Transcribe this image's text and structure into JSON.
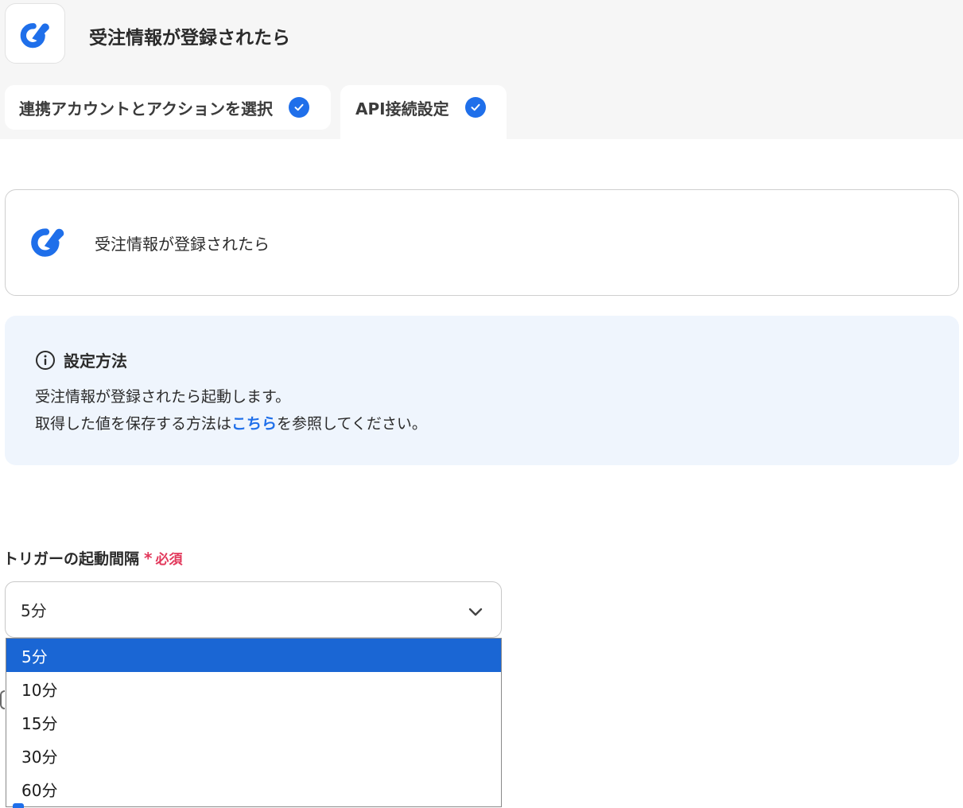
{
  "header": {
    "title": "受注情報が登録されたら",
    "app_icon": "app-logo-icon",
    "brand_color": "#1f6fea"
  },
  "tabs": [
    {
      "label": "連携アカウントとアクションを選択",
      "completed": true
    },
    {
      "label": "API接続設定",
      "completed": true,
      "active": true
    }
  ],
  "app_card": {
    "title": "受注情報が登録されたら"
  },
  "info": {
    "title": "設定方法",
    "line1": "受注情報が登録されたら起動します。",
    "line2_before": "取得した値を保存する方法は",
    "link_text": "こちら",
    "line2_after": "を参照してください。"
  },
  "trigger_interval": {
    "label": "トリガーの起動間隔",
    "required_mark": "*",
    "required_text": "必須",
    "selected": "5分",
    "options": [
      "5分",
      "10分",
      "15分",
      "30分",
      "60分"
    ]
  },
  "colors": {
    "accent": "#1f6fea",
    "required": "#e2385b",
    "selected_option_bg": "#1a66d4",
    "info_bg": "#eff5fd"
  }
}
